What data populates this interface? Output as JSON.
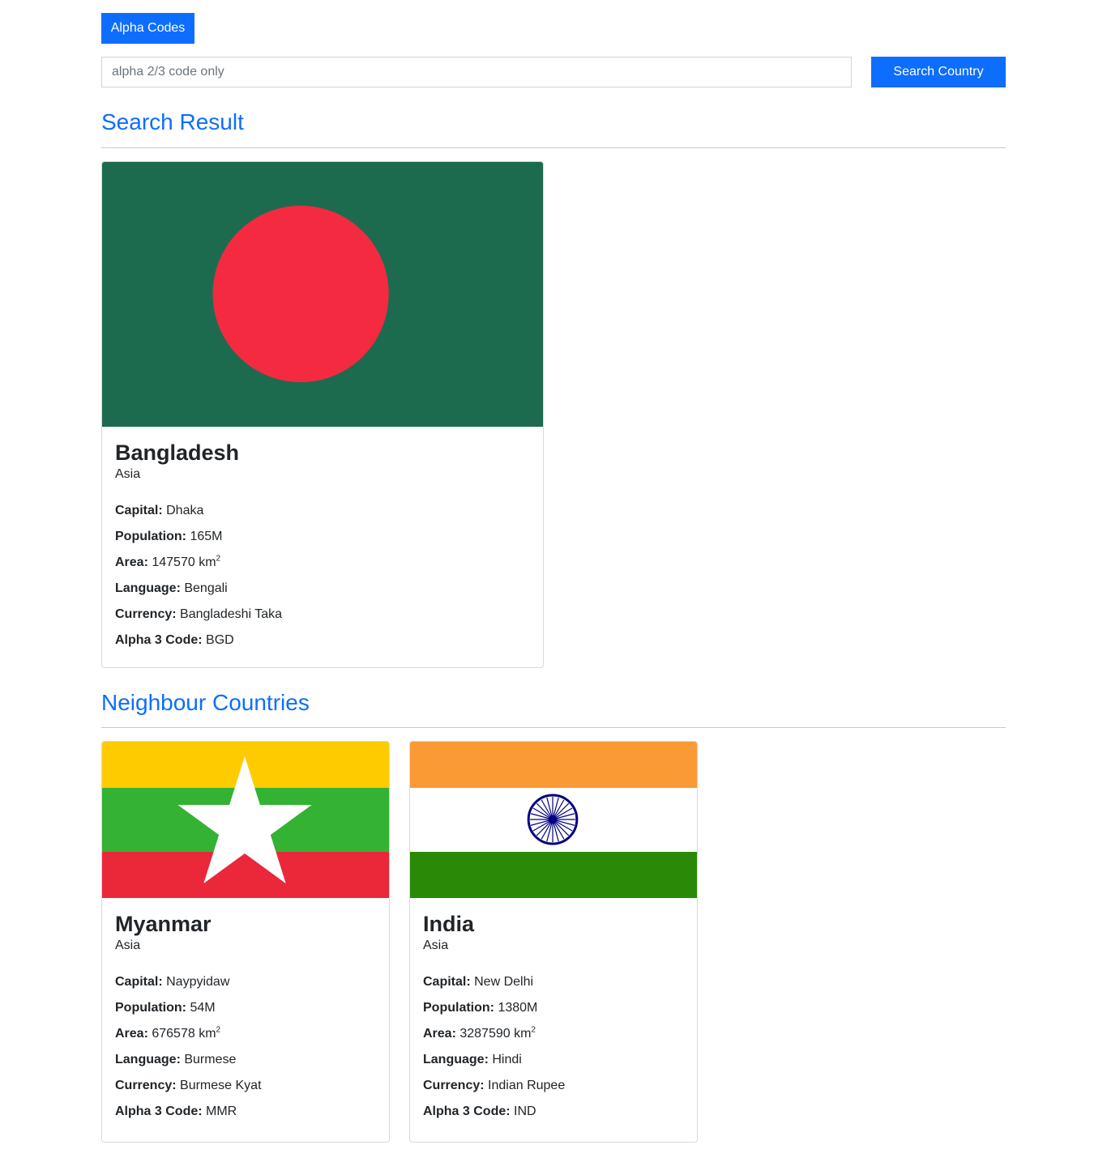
{
  "header": {
    "alpha_codes_label": "Alpha Codes",
    "search_placeholder": "alpha 2/3 code only",
    "search_value": "",
    "search_button_label": "Search Country"
  },
  "search_result": {
    "title": "Search Result",
    "country": {
      "name": "Bangladesh",
      "region": "Asia",
      "flag_icon": "bangladesh-flag",
      "labels": {
        "capital": "Capital:",
        "population": "Population:",
        "area": "Area:",
        "language": "Language:",
        "currency": "Currency:",
        "alpha3": "Alpha 3 Code:"
      },
      "capital": "Dhaka",
      "population": "165M",
      "area": "147570 km",
      "area_unit_exp": "2",
      "language": "Bengali",
      "currency": "Bangladeshi Taka",
      "alpha3": "BGD"
    }
  },
  "neighbours": {
    "title": "Neighbour Countries",
    "countries": [
      {
        "name": "Myanmar",
        "region": "Asia",
        "flag_icon": "myanmar-flag",
        "labels": {
          "capital": "Capital:",
          "population": "Population:",
          "area": "Area:",
          "language": "Language:",
          "currency": "Currency:",
          "alpha3": "Alpha 3 Code:"
        },
        "capital": "Naypyidaw",
        "population": "54M",
        "area": "676578 km",
        "area_unit_exp": "2",
        "language": "Burmese",
        "currency": "Burmese Kyat",
        "alpha3": "MMR"
      },
      {
        "name": "India",
        "region": "Asia",
        "flag_icon": "india-flag",
        "labels": {
          "capital": "Capital:",
          "population": "Population:",
          "area": "Area:",
          "language": "Language:",
          "currency": "Currency:",
          "alpha3": "Alpha 3 Code:"
        },
        "capital": "New Delhi",
        "population": "1380M",
        "area": "3287590 km",
        "area_unit_exp": "2",
        "language": "Hindi",
        "currency": "Indian Rupee",
        "alpha3": "IND"
      }
    ]
  },
  "colors": {
    "accent": "#0d6efd",
    "bangladesh_green": "#1c6b4f",
    "bangladesh_red": "#f42a41",
    "myanmar_yellow": "#fecb00",
    "myanmar_green": "#34b233",
    "myanmar_red": "#ea2839",
    "india_saffron": "#ff9933",
    "india_green": "#138808",
    "india_chakra": "#000080"
  }
}
